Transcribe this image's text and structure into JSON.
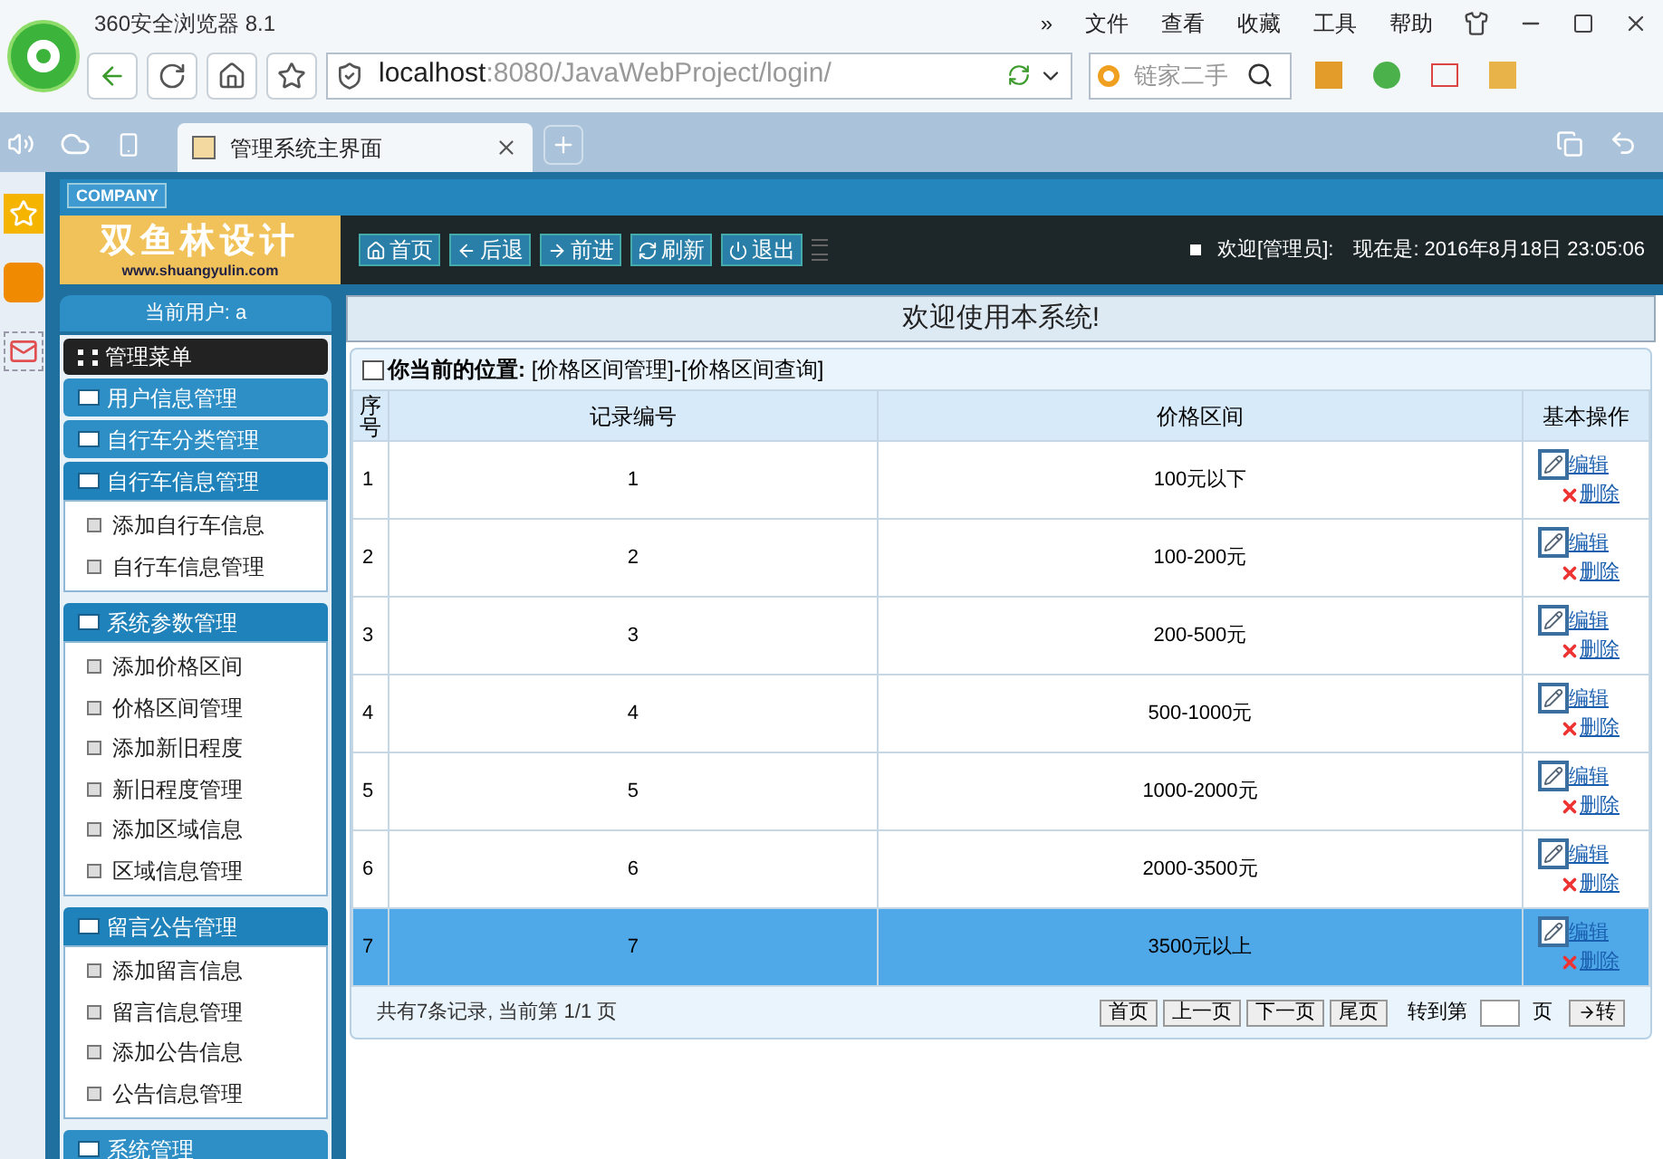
{
  "browser": {
    "title": "360安全浏览器 8.1",
    "menu": [
      "»",
      "文件",
      "查看",
      "收藏",
      "工具",
      "帮助"
    ],
    "url_host": "localhost",
    "url_rest": ":8080/JavaWebProject/login/",
    "search_placeholder": "链家二手",
    "tab_title": "管理系统主界面"
  },
  "header": {
    "company": "COMPANY",
    "logo_text": "双鱼林设计",
    "logo_url": "www.shuangyulin.com",
    "nav": [
      {
        "kind": "home",
        "label": "首页"
      },
      {
        "kind": "back",
        "label": "后退"
      },
      {
        "kind": "forward",
        "label": "前进"
      },
      {
        "kind": "refresh",
        "label": "刷新"
      },
      {
        "kind": "logout",
        "label": "退出"
      }
    ],
    "welcome": "欢迎[管理员]:",
    "time": "现在是: 2016年8月18日 23:05:06"
  },
  "user_bar": "当前用户: a",
  "banner": "欢迎使用本系统!",
  "sidebar": {
    "title": "管理菜单",
    "sections": [
      {
        "label": "用户信息管理",
        "expanded": false
      },
      {
        "label": "自行车分类管理",
        "expanded": false
      },
      {
        "label": "自行车信息管理",
        "expanded": true,
        "children": [
          "添加自行车信息",
          "自行车信息管理"
        ]
      },
      {
        "label": "系统参数管理",
        "expanded": true,
        "children": [
          "添加价格区间",
          "价格区间管理",
          "添加新旧程度",
          "新旧程度管理",
          "添加区域信息",
          "区域信息管理"
        ]
      },
      {
        "label": "留言公告管理",
        "expanded": true,
        "children": [
          "添加留言信息",
          "留言信息管理",
          "添加公告信息",
          "公告信息管理"
        ]
      },
      {
        "label": "系统管理",
        "expanded": false
      }
    ]
  },
  "breadcrumb": {
    "label": "你当前的位置:",
    "path": "[价格区间管理]-[价格区间查询]"
  },
  "table": {
    "columns": [
      "序号",
      "记录编号",
      "价格区间",
      "基本操作"
    ],
    "rows": [
      {
        "cells": [
          "1",
          "1",
          "100元以下"
        ],
        "edit": "编辑",
        "delete": "删除",
        "selected": false
      },
      {
        "cells": [
          "2",
          "2",
          "100-200元"
        ],
        "edit": "编辑",
        "delete": "删除",
        "selected": false
      },
      {
        "cells": [
          "3",
          "3",
          "200-500元"
        ],
        "edit": "编辑",
        "delete": "删除",
        "selected": false
      },
      {
        "cells": [
          "4",
          "4",
          "500-1000元"
        ],
        "edit": "编辑",
        "delete": "删除",
        "selected": false
      },
      {
        "cells": [
          "5",
          "5",
          "1000-2000元"
        ],
        "edit": "编辑",
        "delete": "删除",
        "selected": false
      },
      {
        "cells": [
          "6",
          "6",
          "2000-3500元"
        ],
        "edit": "编辑",
        "delete": "删除",
        "selected": false
      },
      {
        "cells": [
          "7",
          "7",
          "3500元以上"
        ],
        "edit": "编辑",
        "delete": "删除",
        "selected": true
      }
    ]
  },
  "pager": {
    "summary": "共有7条记录, 当前第 1/1 页",
    "buttons": [
      "首页",
      "上一页",
      "下一页",
      "尾页"
    ],
    "goto": "转到第",
    "unit": "页",
    "go": "转"
  }
}
